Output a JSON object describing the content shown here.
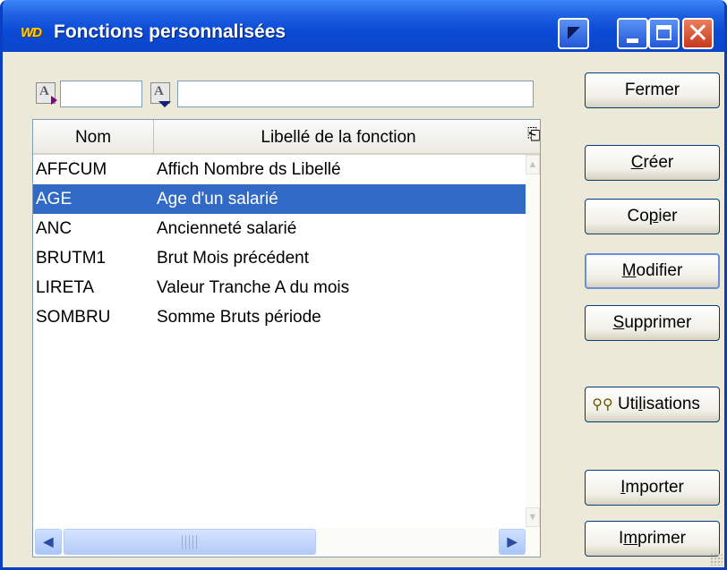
{
  "window": {
    "logo": "WD",
    "title": "Fonctions personnalisées"
  },
  "filters": {
    "nom_value": "",
    "libelle_value": ""
  },
  "table": {
    "columns": [
      "Nom",
      "Libellé de la fonction"
    ],
    "rows": [
      {
        "nom": "AFFCUM",
        "libelle": "Affich Nombre ds Libellé"
      },
      {
        "nom": "AGE",
        "libelle": "Age d'un salarié"
      },
      {
        "nom": "ANC",
        "libelle": "Ancienneté salarié"
      },
      {
        "nom": "BRUTM1",
        "libelle": "Brut Mois précédent"
      },
      {
        "nom": "LIRETA",
        "libelle": "Valeur Tranche A du mois"
      },
      {
        "nom": "SOMBRU",
        "libelle": "Somme Bruts période"
      }
    ],
    "selected_index": 1
  },
  "buttons": {
    "fermer": "Fermer",
    "creer": {
      "mnemonic": "C",
      "rest": "réer"
    },
    "copier": {
      "before": "Co",
      "mnemonic": "p",
      "rest": "ier"
    },
    "modifier": {
      "mnemonic": "M",
      "rest": "odifier"
    },
    "supprimer": {
      "mnemonic": "S",
      "rest": "upprimer"
    },
    "utilisations": {
      "before": "Uti",
      "mnemonic": "l",
      "rest": "isations"
    },
    "importer": {
      "mnemonic": "I",
      "rest": "mporter"
    },
    "imprimer": {
      "before": "I",
      "mnemonic": "m",
      "rest": "primer"
    }
  }
}
